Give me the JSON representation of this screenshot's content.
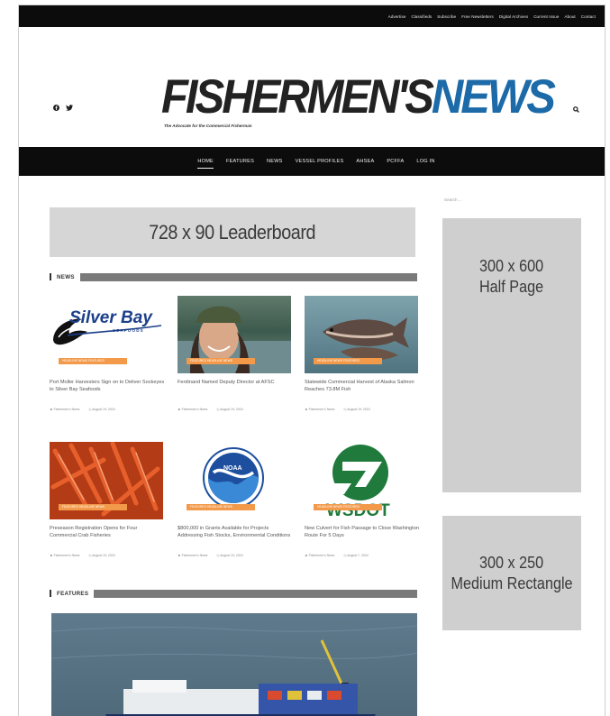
{
  "utility_nav": [
    "Advertise",
    "Classifieds",
    "Subscribe",
    "Free Newsletters",
    "Digital Archives",
    "Current Issue",
    "About",
    "Contact"
  ],
  "brand": {
    "logo_word1": "FISHERMEN'S",
    "logo_word2": "NEWS",
    "tagline": "The Advocate for the Commercial Fisherman",
    "accent": "#1c6aa8"
  },
  "icons": {
    "social": [
      "facebook-icon",
      "twitter-icon"
    ],
    "search": "search-icon"
  },
  "main_nav": [
    {
      "label": "HOME",
      "active": true
    },
    {
      "label": "FEATURES"
    },
    {
      "label": "NEWS"
    },
    {
      "label": "VESSEL PROFILES"
    },
    {
      "label": "AHSEA"
    },
    {
      "label": "PCFFA"
    },
    {
      "label": "LOG IN"
    }
  ],
  "ads": {
    "leaderboard": "728 x 90 Leaderboard",
    "halfpage": [
      "300 x 600",
      "Half Page"
    ],
    "rectangle": [
      "300 x 250",
      "Medium Rectangle"
    ]
  },
  "sidebar": {
    "search_placeholder": "Search ..."
  },
  "sections": {
    "news": "NEWS",
    "features": "FEATURES"
  },
  "news_cards": [
    {
      "tag": "HEADLINE NEWS FEATURED",
      "title": "Port Moller Harvesters Sign on to Deliver Sockeyes to Silver Bay Seafoods",
      "author": "Fishermen's News",
      "date": "August 19, 2024"
    },
    {
      "tag": "FEATURED HEADLINE NEWS",
      "title": "Ferdinand Named Deputy Director at AFSC",
      "author": "Fishermen's News",
      "date": "August 19, 2024"
    },
    {
      "tag": "HEADLINE NEWS FEATURED",
      "title": "Statewide Commercial Harvest of Alaska Salmon Reaches 73.8M Fish",
      "author": "Fishermen's News",
      "date": "August 19, 2024"
    },
    {
      "tag": "FEATURED HEADLINE NEWS",
      "title": "Preseason Registration Opens for Four Commercial Crab Fisheries",
      "author": "Fishermen's News",
      "date": "August 19, 2024"
    },
    {
      "tag": "FEATURED HEADLINE NEWS",
      "title": "$800,000 in Grants Available for Projects Addressing Fish Stocks, Environmental Conditions",
      "author": "Fishermen's News",
      "date": "August 19, 2024"
    },
    {
      "tag": "HEADLINE NEWS FEATURED",
      "title": "New Culvert for Fish Passage to Close Washington Route For 5 Days",
      "author": "Fishermen's News",
      "date": "August 7, 2024"
    }
  ],
  "thumb_logos": {
    "silver_bay": "Silver Bay",
    "silver_bay_sub": "SEAFOODS",
    "noaa": "NOAA",
    "wsdot": "WSDOT"
  }
}
